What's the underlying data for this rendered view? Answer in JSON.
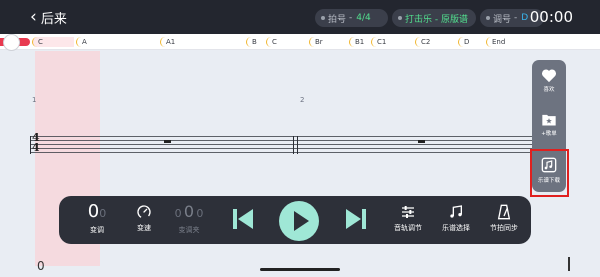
{
  "header": {
    "back_label": "后来",
    "meter": {
      "label": "拍号",
      "value": "4/4"
    },
    "mode": {
      "label": "打击乐 - 原版谱"
    },
    "key": {
      "label": "调号",
      "value": "D"
    },
    "time": "00:00"
  },
  "sections": [
    "C",
    "A",
    "A1",
    "B",
    "C",
    "Br",
    "B1",
    "C1",
    "C2",
    "D",
    "End"
  ],
  "score": {
    "measure_numbers": [
      "1",
      "2"
    ],
    "time_signature": {
      "top": "4",
      "bottom": "4"
    },
    "counter": "0"
  },
  "side_panel": {
    "like_label": "喜欢",
    "add_list_label": "+歌单",
    "download_label": "乐谱下载"
  },
  "controls": {
    "transpose": {
      "value": "0",
      "small": "0",
      "label": "变调"
    },
    "speed": {
      "label": "变速"
    },
    "capo": {
      "value": "0",
      "small": "0",
      "extra": "0",
      "label": "变调夹"
    },
    "track": {
      "label": "音轨调节"
    },
    "score_select": {
      "label": "乐谱选择"
    },
    "sync": {
      "label": "节拍同步"
    }
  },
  "colors": {
    "accent_green": "#52e08f",
    "accent_blue": "#39b6ee",
    "play_button": "#9fe7d6",
    "progress_red": "#e8394f",
    "highlight_red": "#e0201f"
  }
}
